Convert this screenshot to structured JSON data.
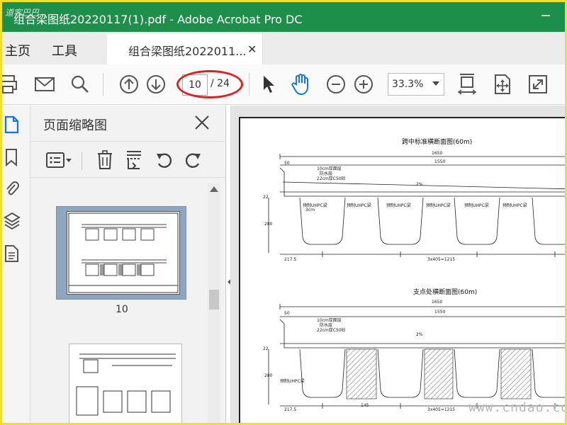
{
  "window": {
    "logo_text": "道客巴巴",
    "title": "组合梁图纸20220117(1).pdf - Adobe Acrobat Pro DC"
  },
  "tabs": {
    "home": "主页",
    "tools": "工具",
    "document": "组合梁图纸2022011..."
  },
  "toolbar": {
    "current_page": "10",
    "total_pages": "/ 24",
    "zoom": "33.3%"
  },
  "thumbnail_panel": {
    "title": "页面缩略图",
    "thumbnails": [
      {
        "label": "10"
      },
      {
        "label": ""
      }
    ]
  },
  "document": {
    "section1_title": "跨中标准横断面图(60m)",
    "section2_title": "支点处横断面图(60m)",
    "dims": {
      "total_width": "1650",
      "deck_width": "1550",
      "edge": "50",
      "deck_note1": "10cm厚面层",
      "deck_note2": "防水层",
      "deck_note3": "22cm厚C50砼",
      "slope": "2%",
      "girder_label": "预制UHPC梁",
      "side": "217.5",
      "spans": "3x405=1215",
      "height": "280",
      "top": "22",
      "web": "3cm",
      "mid": "145"
    },
    "watermark": "www.cndao.com"
  },
  "colors": {
    "title_bar": "#1e8f4a",
    "accent_blue": "#1473e6",
    "annotation_red": "#e02020",
    "frame_yellow": "#f0e02a"
  }
}
